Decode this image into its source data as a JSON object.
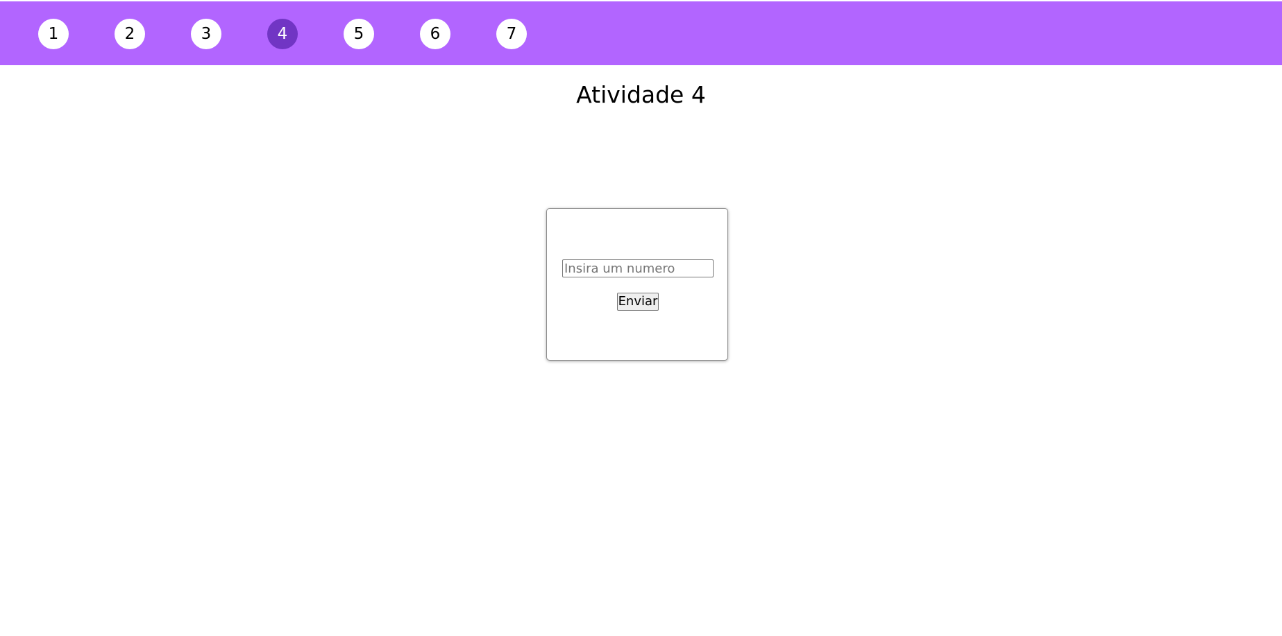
{
  "nav": {
    "items": [
      {
        "label": "1",
        "active": false
      },
      {
        "label": "2",
        "active": false
      },
      {
        "label": "3",
        "active": false
      },
      {
        "label": "4",
        "active": true
      },
      {
        "label": "5",
        "active": false
      },
      {
        "label": "6",
        "active": false
      },
      {
        "label": "7",
        "active": false
      }
    ],
    "bar_color": "#b265ff",
    "active_color": "#7135c4"
  },
  "page": {
    "title": "Atividade 4"
  },
  "form": {
    "input_placeholder": "Insira um numero",
    "input_value": "",
    "submit_label": "Enviar"
  }
}
